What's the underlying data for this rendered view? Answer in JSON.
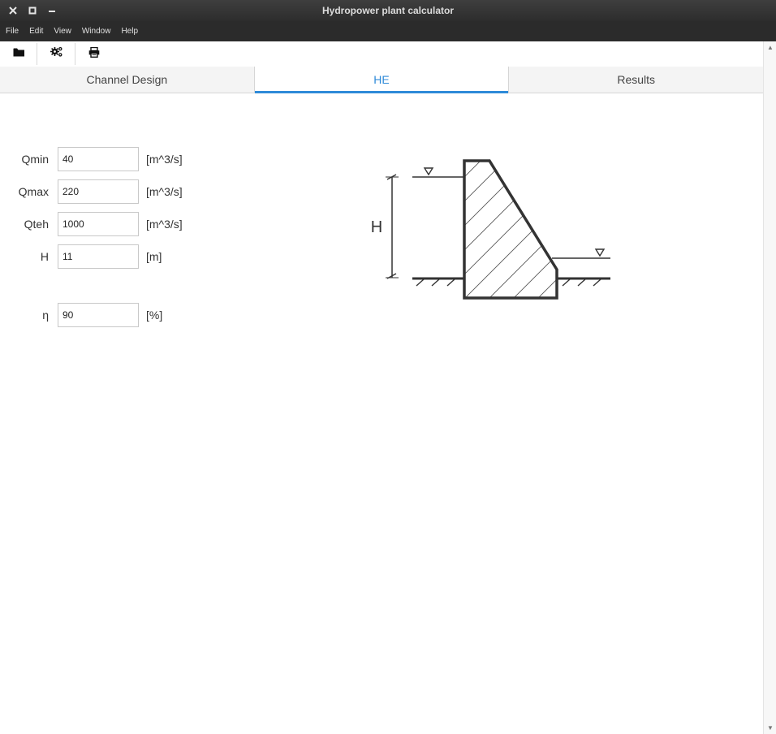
{
  "window": {
    "title": "Hydropower plant calculator"
  },
  "menu": [
    "File",
    "Edit",
    "View",
    "Window",
    "Help"
  ],
  "toolbar": {
    "icons": [
      "folder-icon",
      "gears-icon",
      "print-icon"
    ]
  },
  "tabs": [
    {
      "label": "Channel Design",
      "active": false
    },
    {
      "label": "HE",
      "active": true
    },
    {
      "label": "Results",
      "active": false
    }
  ],
  "form": {
    "qmin": {
      "label": "Qmin",
      "value": "40",
      "unit": "[m^3/s]"
    },
    "qmax": {
      "label": "Qmax",
      "value": "220",
      "unit": "[m^3/s]"
    },
    "qteh": {
      "label": "Qteh",
      "value": "1000",
      "unit": "[m^3/s]"
    },
    "h": {
      "label": "H",
      "value": "11",
      "unit": "[m]"
    },
    "eta": {
      "label": "η",
      "value": "90",
      "unit": "[%]"
    }
  },
  "diagram": {
    "height_label": "H"
  },
  "colors": {
    "accent": "#2e8ad8",
    "titlebar": "#333333",
    "menubar": "#2b2b2b"
  }
}
